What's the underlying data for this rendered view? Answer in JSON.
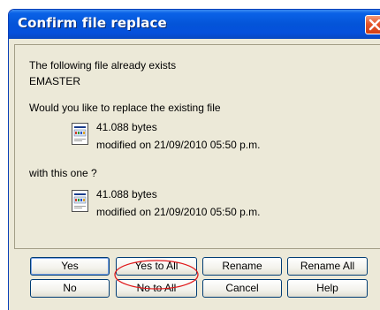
{
  "dialog": {
    "title": "Confirm file replace",
    "line_exists": "The following file already exists",
    "filename": "EMASTER",
    "question": "Would you like to replace the existing file",
    "existing_file": {
      "size": "41.088 bytes",
      "modified": "modified on 21/09/2010 05:50 p.m."
    },
    "with_label": "with this one ?",
    "new_file": {
      "size": "41.088 bytes",
      "modified": "modified on 21/09/2010 05:50 p.m."
    }
  },
  "buttons": {
    "yes": "Yes",
    "yes_to_all": "Yes to All",
    "rename": "Rename",
    "rename_all": "Rename All",
    "no": "No",
    "no_to_all": "No to All",
    "cancel": "Cancel",
    "help": "Help"
  },
  "colors": {
    "titlebar": "#0454d8",
    "dialog_bg": "#ece9d8",
    "close_button": "#e5562b",
    "highlight": "#e0191b"
  },
  "icons": {
    "close": "close-icon",
    "file": "document-icon"
  }
}
